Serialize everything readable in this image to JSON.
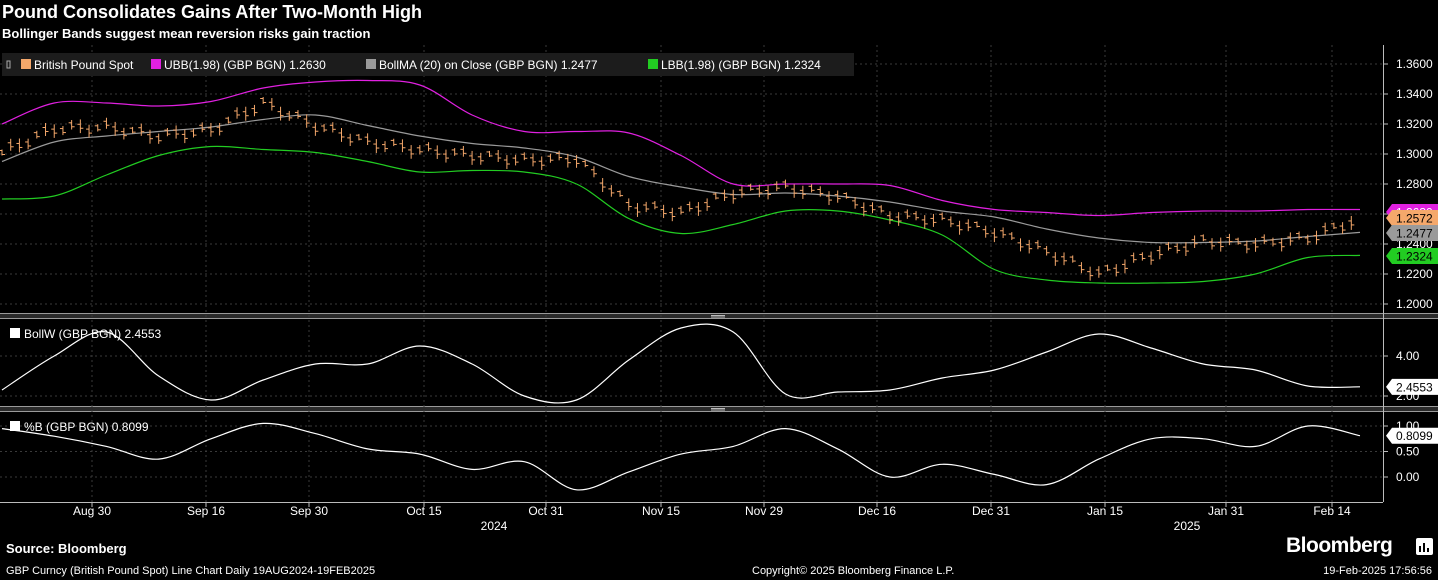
{
  "header": {
    "title": "Pound Consolidates Gains After Two-Month High",
    "subtitle": "Bollinger Bands suggest mean reversion risks gain traction"
  },
  "footer": {
    "source": "Source: Bloomberg",
    "description": "GBP Curncy (British Pound Spot) Line Chart  Daily 19AUG2024-19FEB2025",
    "copyright": "Copyright© 2025 Bloomberg Finance L.P.",
    "timestamp": "19-Feb-2025 17:56:56",
    "brand": "Bloomberg"
  },
  "colors": {
    "background": "#000000",
    "price": "#f5a86b",
    "upper_band": "#e020e0",
    "moving_average": "#8c8c8c",
    "lower_band": "#22cc22",
    "indicator": "#ffffff",
    "grid": "#3a3a3a"
  },
  "chart_data": [
    {
      "type": "line",
      "panel": "main",
      "legend": [
        {
          "label": "British Pound Spot",
          "color": "#f5a86b"
        },
        {
          "label": "UBB(1.98) (GBP BGN) 1.2630",
          "color": "#e020e0"
        },
        {
          "label": "BollMA (20)  on Close (GBP BGN) 1.2477",
          "color": "#9a9a9a"
        },
        {
          "label": "LBB(1.98) (GBP BGN) 1.2324",
          "color": "#22cc22"
        }
      ],
      "yticks": [
        "1.3600",
        "1.3400",
        "1.3200",
        "1.3000",
        "1.2800",
        "1.2600",
        "1.2400",
        "1.2200",
        "1.2000"
      ],
      "ylim": [
        1.1935,
        1.3665
      ],
      "last_value_labels": [
        {
          "text": "1.2630",
          "value": 1.263,
          "color": "#e020e0"
        },
        {
          "text": "1.2572",
          "value": 1.2572,
          "color": "#f5a86b"
        },
        {
          "text": "1.2477",
          "value": 1.2477,
          "color": "#9a9a9a"
        },
        {
          "text": "1.2324",
          "value": 1.2324,
          "color": "#22cc22"
        }
      ],
      "x": [
        "2024-08-19",
        "2024-08-26",
        "2024-09-02",
        "2024-09-09",
        "2024-09-16",
        "2024-09-23",
        "2024-09-30",
        "2024-10-07",
        "2024-10-14",
        "2024-10-21",
        "2024-10-28",
        "2024-11-04",
        "2024-11-11",
        "2024-11-18",
        "2024-11-25",
        "2024-12-02",
        "2024-12-09",
        "2024-12-16",
        "2024-12-23",
        "2024-12-30",
        "2025-01-06",
        "2025-01-13",
        "2025-01-20",
        "2025-01-27",
        "2025-02-03",
        "2025-02-10",
        "2025-02-19"
      ],
      "series": [
        {
          "name": "British Pound Spot",
          "values": [
            1.301,
            1.317,
            1.318,
            1.312,
            1.316,
            1.334,
            1.319,
            1.308,
            1.303,
            1.299,
            1.296,
            1.297,
            1.266,
            1.261,
            1.274,
            1.278,
            1.272,
            1.259,
            1.256,
            1.248,
            1.235,
            1.22,
            1.233,
            1.242,
            1.24,
            1.244,
            1.2572
          ]
        },
        {
          "name": "UBB(1.98) (GBP BGN)",
          "values": [
            1.32,
            1.334,
            1.334,
            1.332,
            1.335,
            1.344,
            1.348,
            1.349,
            1.346,
            1.326,
            1.315,
            1.315,
            1.314,
            1.299,
            1.28,
            1.28,
            1.28,
            1.279,
            1.269,
            1.263,
            1.261,
            1.259,
            1.261,
            1.262,
            1.262,
            1.263,
            1.263
          ]
        },
        {
          "name": "BollMA (20) on Close (GBP BGN)",
          "values": [
            1.295,
            1.308,
            1.312,
            1.315,
            1.318,
            1.323,
            1.326,
            1.319,
            1.312,
            1.307,
            1.304,
            1.298,
            1.285,
            1.278,
            1.273,
            1.274,
            1.272,
            1.268,
            1.262,
            1.258,
            1.25,
            1.244,
            1.241,
            1.241,
            1.242,
            1.245,
            1.2477
          ]
        },
        {
          "name": "LBB(1.98) (GBP BGN)",
          "values": [
            1.27,
            1.272,
            1.286,
            1.299,
            1.305,
            1.303,
            1.301,
            1.295,
            1.288,
            1.289,
            1.288,
            1.28,
            1.257,
            1.247,
            1.253,
            1.262,
            1.262,
            1.256,
            1.246,
            1.223,
            1.216,
            1.214,
            1.214,
            1.215,
            1.22,
            1.231,
            1.2324
          ]
        }
      ]
    },
    {
      "type": "line",
      "panel": "bollw",
      "legend": [
        {
          "label": "BollW (GBP BGN) 2.4553",
          "color": "#ffffff"
        }
      ],
      "yticks": [
        "4.00",
        "2.00"
      ],
      "ylim": [
        1.3,
        5.9
      ],
      "last_value_labels": [
        {
          "text": "2.4553",
          "value": 2.4553,
          "color": "#ffffff"
        }
      ],
      "series": [
        {
          "name": "BollW (GBP BGN)",
          "values": [
            2.3,
            4.0,
            5.2,
            3.0,
            1.8,
            2.8,
            3.6,
            3.6,
            4.5,
            3.6,
            2.0,
            1.8,
            3.8,
            5.4,
            5.2,
            2.1,
            2.2,
            2.3,
            2.9,
            3.3,
            4.2,
            5.1,
            4.4,
            3.6,
            3.3,
            2.5,
            2.46
          ]
        }
      ]
    },
    {
      "type": "line",
      "panel": "percent_b",
      "legend": [
        {
          "label": "%B (GBP BGN) 0.8099",
          "color": "#ffffff"
        }
      ],
      "yticks": [
        "1.00",
        "0.50",
        "0.00"
      ],
      "ylim": [
        -0.45,
        1.2
      ],
      "last_value_labels": [
        {
          "text": "0.8099",
          "value": 0.8099,
          "color": "#ffffff"
        }
      ],
      "series": [
        {
          "name": "%B (GBP BGN)",
          "values": [
            0.95,
            0.8,
            0.6,
            0.35,
            0.75,
            1.05,
            0.85,
            0.55,
            0.45,
            0.15,
            0.3,
            -0.25,
            0.1,
            0.45,
            0.6,
            0.95,
            0.55,
            0.0,
            0.25,
            0.05,
            -0.15,
            0.35,
            0.75,
            0.75,
            0.6,
            1.0,
            0.81
          ]
        }
      ]
    }
  ],
  "x_axis": {
    "tick_labels": [
      "Aug 30",
      "Sep 16",
      "Sep 30",
      "Oct 15",
      "Oct 31",
      "Nov 15",
      "Nov 29",
      "Dec 16",
      "Dec 31",
      "Jan 15",
      "Jan 31",
      "Feb 14"
    ],
    "year_labels": [
      "2024",
      "2025"
    ]
  }
}
